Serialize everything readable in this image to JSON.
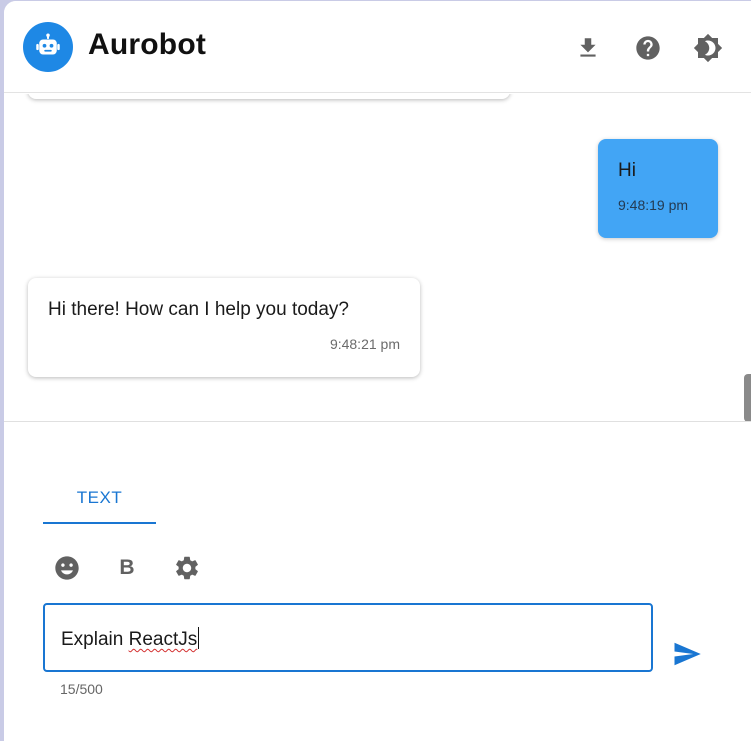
{
  "header": {
    "title": "Aurobot",
    "avatar_icon": "robot-icon",
    "actions": [
      {
        "name": "download-icon",
        "label": "Download"
      },
      {
        "name": "help-icon",
        "label": "Help"
      },
      {
        "name": "brightness-icon",
        "label": "Theme"
      }
    ]
  },
  "messages": [
    {
      "sender": "user",
      "text": "Hi",
      "time": "9:48:19 pm"
    },
    {
      "sender": "bot",
      "text": "Hi there! How can I help you today?",
      "time": "9:48:21 pm"
    }
  ],
  "composer": {
    "tabs": [
      {
        "label": "TEXT",
        "active": true
      }
    ],
    "toolbar": [
      "emoji-icon",
      "bold-icon",
      "settings-icon"
    ],
    "bold_label": "B",
    "input_value_plain": "Explain ",
    "input_value_misspelled": "ReactJs",
    "char_count": "15/500"
  },
  "colors": {
    "accent": "#1976d2",
    "avatar": "#1e88e5",
    "user_bubble": "#42a5f5",
    "icon_gray": "#616161"
  }
}
